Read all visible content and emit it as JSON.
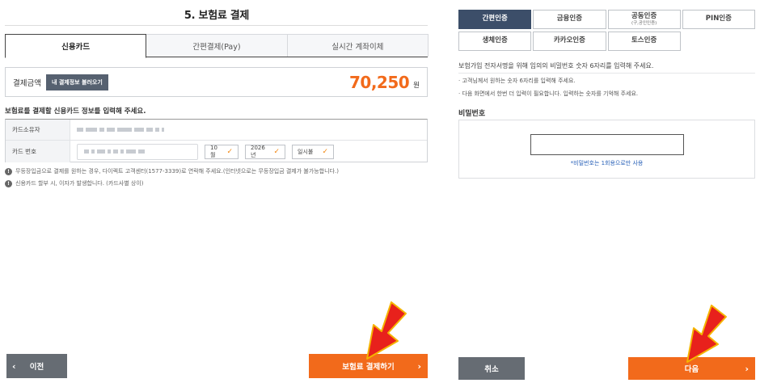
{
  "payment": {
    "title": "5. 보험료 결제",
    "tabs": [
      {
        "label": "신용카드",
        "active": true
      },
      {
        "label": "간편결제(Pay)",
        "active": false
      },
      {
        "label": "실시간 계좌이체",
        "active": false
      }
    ],
    "amount_label": "결제금액",
    "load_button": "내 결제정보 불러오기",
    "amount_value": "70,250",
    "amount_unit": "원",
    "card_guide": "보험료를 결제할 신용카드 정보를 입력해 주세요.",
    "card_holder_label": "카드소유자",
    "card_number_label": "카드 번호",
    "expiry_month": "10월",
    "expiry_year": "2026년",
    "installment": "일시불",
    "notices": [
      "무등장입금으로 결제를 원하는 경우, 다이렉트 고객센터(1577-3339)로 연락해 주세요.(인터넷으로는 무등장입금 결제가 불가능합니다.)",
      "신용카드 할부 시, 이자가 발생합니다. (카드사별 상이)"
    ],
    "prev_button": "이전",
    "pay_button": "보험료 결제하기"
  },
  "auth": {
    "methods": [
      {
        "label": "간편인증",
        "sub": "",
        "active": true
      },
      {
        "label": "금융인증",
        "sub": "",
        "active": false
      },
      {
        "label": "공동인증",
        "sub": "(구,공인인증)",
        "active": false
      },
      {
        "label": "PIN인증",
        "sub": "",
        "active": false
      },
      {
        "label": "생체인증",
        "sub": "",
        "active": false
      },
      {
        "label": "카카오인증",
        "sub": "",
        "active": false
      },
      {
        "label": "토스인증",
        "sub": "",
        "active": false
      }
    ],
    "guide": "보험가입 전자서명을 위해 임의의 비밀번호 숫자 6자리를 입력해 주세요.",
    "bullets": [
      "· 고객님께서 원하는 숫자 6자리를 입력해 주세요.",
      "· 다음 화면에서 한번 더 입력이 필요합니다. 입력하는 숫자를 기억해 주세요."
    ],
    "password_label": "비밀번호",
    "password_note": "*비밀번호는 1회용으로만 사용",
    "cancel_button": "취소",
    "next_button": "다음"
  },
  "colors": {
    "accent": "#f26a1b",
    "active_tab": "#3c4e69",
    "gray_button": "#666c73",
    "arrow": "#e8211c"
  },
  "icons": {
    "notice": "info-circle-icon",
    "select_check": "check-icon",
    "chevron_left": "chevron-left-icon",
    "chevron_right": "chevron-right-icon",
    "pointer_arrow": "red-arrow-icon"
  }
}
